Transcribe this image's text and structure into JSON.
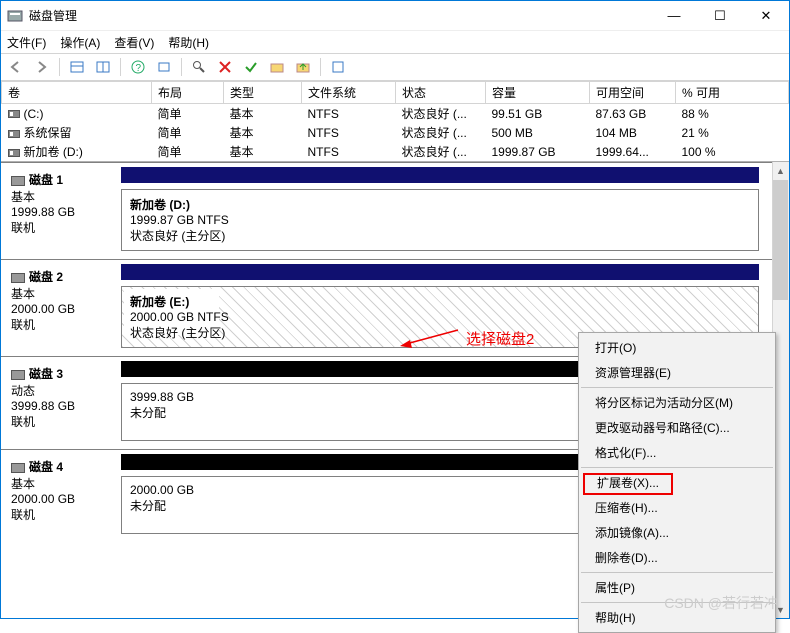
{
  "window": {
    "title": "磁盘管理",
    "min": "—",
    "max": "☐",
    "close": "✕"
  },
  "menu": {
    "file": "文件(F)",
    "action": "操作(A)",
    "view": "查看(V)",
    "help": "帮助(H)"
  },
  "cols": {
    "vol": "卷",
    "layout": "布局",
    "type": "类型",
    "fs": "文件系统",
    "status": "状态",
    "cap": "容量",
    "free": "可用空间",
    "pct": "% 可用"
  },
  "rows": [
    {
      "vol": "(C:)",
      "layout": "简单",
      "type": "基本",
      "fs": "NTFS",
      "status": "状态良好 (...",
      "cap": "99.51 GB",
      "free": "87.63 GB",
      "pct": "88 %"
    },
    {
      "vol": "系统保留",
      "layout": "简单",
      "type": "基本",
      "fs": "NTFS",
      "status": "状态良好 (...",
      "cap": "500 MB",
      "free": "104 MB",
      "pct": "21 %"
    },
    {
      "vol": "新加卷 (D:)",
      "layout": "简单",
      "type": "基本",
      "fs": "NTFS",
      "status": "状态良好 (...",
      "cap": "1999.87 GB",
      "free": "1999.64...",
      "pct": "100 %"
    }
  ],
  "disks": [
    {
      "name": "磁盘 1",
      "t1": "基本",
      "t2": "1999.88 GB",
      "t3": "联机",
      "hdr": "blue",
      "pname": "新加卷   (D:)",
      "pline2": "1999.87 GB NTFS",
      "pline3": "状态良好 (主分区)",
      "hatched": false
    },
    {
      "name": "磁盘 2",
      "t1": "基本",
      "t2": "2000.00 GB",
      "t3": "联机",
      "hdr": "blue",
      "pname": "新加卷   (E:)",
      "pline2": "2000.00 GB NTFS",
      "pline3": "状态良好 (主分区)",
      "hatched": true
    },
    {
      "name": "磁盘 3",
      "t1": "动态",
      "t2": "3999.88 GB",
      "t3": "联机",
      "hdr": "black",
      "pname": "",
      "pline2": "3999.88 GB",
      "pline3": "未分配",
      "hatched": false
    },
    {
      "name": "磁盘 4",
      "t1": "基本",
      "t2": "2000.00 GB",
      "t3": "联机",
      "hdr": "black",
      "pname": "",
      "pline2": "2000.00 GB",
      "pline3": "未分配",
      "hatched": false
    }
  ],
  "ctx": {
    "open": "打开(O)",
    "explorer": "资源管理器(E)",
    "markactive": "将分区标记为活动分区(M)",
    "changeletter": "更改驱动器号和路径(C)...",
    "format": "格式化(F)...",
    "extend": "扩展卷(X)...",
    "shrink": "压缩卷(H)...",
    "mirror": "添加镜像(A)...",
    "delete": "删除卷(D)...",
    "prop": "属性(P)",
    "help": "帮助(H)"
  },
  "annotation": "选择磁盘2",
  "watermark": "CSDN @若行若冲"
}
